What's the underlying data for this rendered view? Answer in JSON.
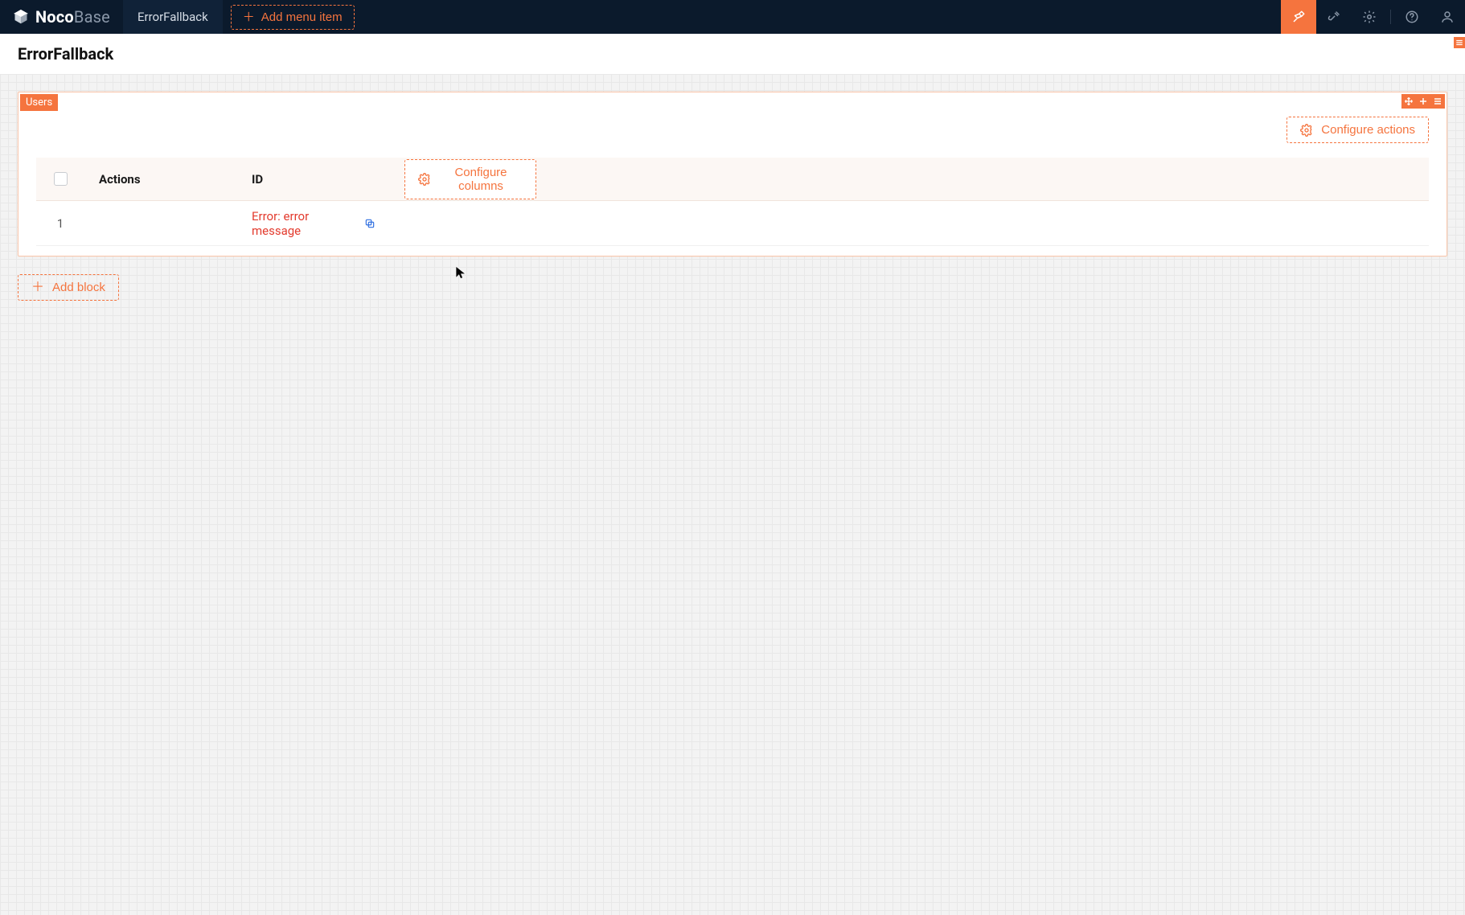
{
  "brand": {
    "bold": "Noco",
    "light": "Base"
  },
  "topbar": {
    "tab_label": "ErrorFallback",
    "add_menu_label": "Add menu item"
  },
  "page": {
    "title": "ErrorFallback"
  },
  "block": {
    "tag": "Users",
    "configure_actions_label": "Configure actions",
    "configure_columns_label": "Configure columns",
    "columns": {
      "actions": "Actions",
      "id": "ID"
    },
    "rows": [
      {
        "num": "1",
        "error": "Error: error message"
      }
    ]
  },
  "add_block_label": "Add block",
  "colors": {
    "accent": "#f5743e",
    "error": "#e33b2e"
  }
}
